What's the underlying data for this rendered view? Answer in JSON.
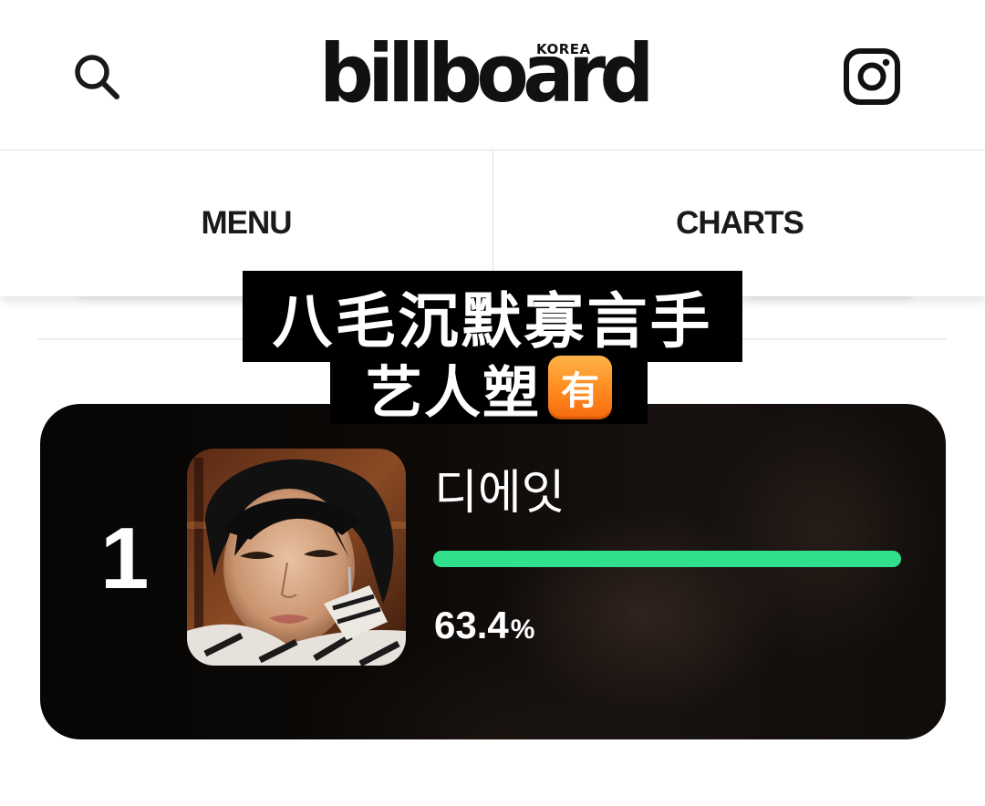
{
  "header": {
    "logo_text": "billboard",
    "logo_region": "KOREA",
    "search_icon": "search-icon",
    "instagram_icon": "instagram-icon"
  },
  "nav": {
    "tabs": [
      {
        "label": "MENU"
      },
      {
        "label": "CHARTS"
      }
    ]
  },
  "caption": {
    "line1": "八毛沉默寡言手",
    "line2": "艺人塑",
    "badge": "有",
    "badge_color": "#ff8a1f"
  },
  "ranking": {
    "rank": "1",
    "artist": "디에잇",
    "percent_value": "63.4",
    "percent_unit": "%",
    "vote_fraction": 1.0,
    "bar_color": "#30e08c"
  }
}
